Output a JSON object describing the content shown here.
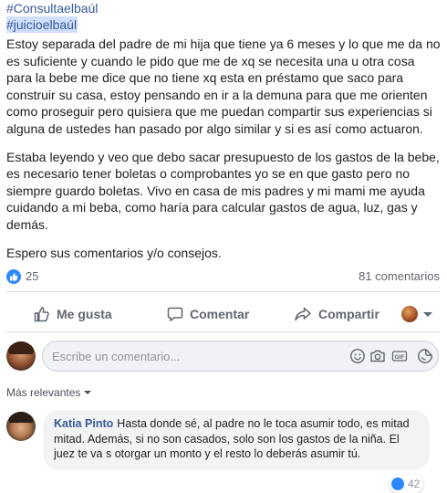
{
  "post": {
    "hashtags": [
      "#Consultaelbaúl",
      "#juicioelbaúl"
    ],
    "paragraphs": [
      "Estoy separada del padre de mi hija que tiene ya 6 meses y lo que me da no es suficiente y cuando le pido que me de xq se necesita una u otra cosa para la bebe me dice que no tiene xq esta en préstamo que saco para construir su casa, estoy pensando en ir a la demuna para que me orienten como proseguir pero quisiera que me puedan compartir sus experiencias si alguna de ustedes han pasado por algo similar y si es así como actuaron.",
      "Estaba leyendo y veo que debo sacar presupuesto de los gastos de la bebe, es necesario tener boletas o comprobantes yo se en que gasto pero no siempre guardo boletas. Vivo en casa de mis padres y mi mami me ayuda cuidando a mi beba, como haría para calcular gastos de agua, luz, gas y demás.",
      "Espero sus comentarios y/o consejos."
    ]
  },
  "stats": {
    "reactions": "25",
    "comments": "81 comentarios"
  },
  "actions": {
    "like": "Me gusta",
    "comment": "Comentar",
    "share": "Compartir"
  },
  "composer": {
    "placeholder": "Escribe un comentario..."
  },
  "icons": [
    "like-icon",
    "comment-icon",
    "share-icon",
    "emoji-icon",
    "camera-icon",
    "gif-icon",
    "sticker-icon",
    "chevron-down-icon"
  ],
  "filter": {
    "label": "Más relevantes"
  },
  "comments": [
    {
      "author": "Katia Pinto",
      "text": "Hasta donde sé, al padre no le toca asumir todo, es mitad mitad. Además, si no son casados, solo son los gastos de la niña. El juez te va s otorgar un monto y el resto lo deberás asumir tú.",
      "reactions": "42"
    }
  ],
  "colors": {
    "link": "#385898",
    "accent": "#2d88ff",
    "muted": "#606770"
  }
}
